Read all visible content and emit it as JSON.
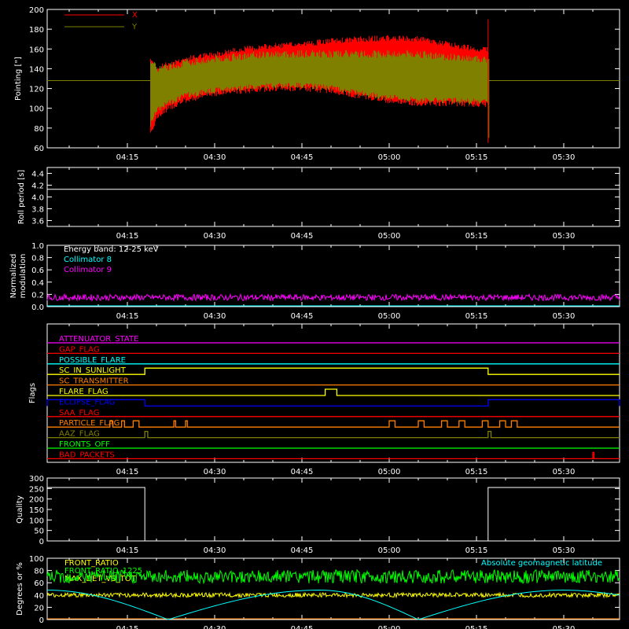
{
  "colors": {
    "background": "#000000",
    "axes": "#ffffff",
    "x": "#ff0000",
    "y": "#7f7f00",
    "cyan": "#00ffff",
    "magenta": "#ff00ff",
    "yellow": "#ffff00",
    "green": "#00ff00",
    "orange": "#ff7f00",
    "blue": "#0000ff",
    "red": "#ff0000"
  },
  "time_ticks": [
    "04:15",
    "04:30",
    "04:45",
    "05:00",
    "05:15",
    "05:30"
  ],
  "chart_data": [
    {
      "type": "area",
      "ylabel": "Pointing [\"]",
      "ylim": [
        60,
        200
      ],
      "yticks": [
        "60",
        "80",
        "100",
        "120",
        "140",
        "160",
        "180",
        "200"
      ],
      "x": [
        "04:19",
        "04:20",
        "04:22",
        "04:25",
        "04:30",
        "04:35",
        "04:40",
        "04:45",
        "04:50",
        "04:55",
        "05:00",
        "05:05",
        "05:10",
        "05:15",
        "05:17"
      ],
      "series": [
        {
          "name": "X",
          "upper": [
            150,
            140,
            145,
            150,
            155,
            160,
            163,
            165,
            168,
            170,
            171,
            170,
            165,
            160,
            160
          ],
          "lower": [
            75,
            90,
            100,
            108,
            115,
            118,
            120,
            120,
            118,
            112,
            108,
            105,
            105,
            104,
            104
          ]
        },
        {
          "name": "Y",
          "upper": [
            150,
            140,
            142,
            146,
            150,
            153,
            155,
            155,
            155,
            155,
            155,
            155,
            152,
            150,
            150
          ],
          "lower": [
            80,
            95,
            102,
            110,
            115,
            118,
            120,
            120,
            118,
            112,
            108,
            105,
            105,
            104,
            104
          ]
        }
      ],
      "baseline": 128,
      "legend": "top-left"
    },
    {
      "type": "line",
      "ylabel": "Roll period [s]",
      "ylim": [
        3.5,
        4.5
      ],
      "yticks": [
        "3.6",
        "3.8",
        "4.0",
        "4.2",
        "4.4"
      ],
      "value": 4.13
    },
    {
      "type": "line",
      "ylabel": "Normalized modulation",
      "ylim": [
        0,
        1.0
      ],
      "yticks": [
        "0.0",
        "0.2",
        "0.4",
        "0.6",
        "0.8",
        "1.0"
      ],
      "title": "Energy band: 12-25 keV",
      "series": [
        {
          "name": "Collimator 8",
          "mean": 0.0
        },
        {
          "name": "Collimator 9",
          "mean": 0.15
        }
      ]
    },
    {
      "type": "table",
      "ylabel": "Flags",
      "flags": [
        {
          "name": "ATTENUATOR_STATE",
          "color": "#ff00ff",
          "on": []
        },
        {
          "name": "GAP_FLAG",
          "color": "#ff0000",
          "on": []
        },
        {
          "name": "POSSIBLE_FLARE",
          "color": "#00ffff",
          "on": []
        },
        {
          "name": "SC_IN_SUNLIGHT",
          "color": "#ffff00",
          "on": [
            [
              "04:18",
              "05:17"
            ]
          ]
        },
        {
          "name": "SC_TRANSMITTER",
          "color": "#ff7f00",
          "on": []
        },
        {
          "name": "FLARE_FLAG",
          "color": "#ffff00",
          "on": [
            [
              "04:49",
              "04:51"
            ]
          ]
        },
        {
          "name": "ECLIPSE_FLAG",
          "color": "#0000ff",
          "on": [
            [
              "03:59",
              "04:18"
            ],
            [
              "05:17",
              "05:42"
            ]
          ]
        },
        {
          "name": "SAA_FLAG",
          "color": "#ff0000",
          "on": []
        },
        {
          "name": "PARTICLE_FLAG",
          "color": "#ff7f00",
          "on": [
            [
              "04:12",
              "04:12.5"
            ],
            [
              "04:14",
              "04:14.5"
            ],
            [
              "04:16",
              "04:17"
            ],
            [
              "04:23",
              "04:23.3"
            ],
            [
              "04:25",
              "04:25.3"
            ],
            [
              "05:00",
              "05:01"
            ],
            [
              "05:05",
              "05:06"
            ],
            [
              "05:09",
              "05:10"
            ],
            [
              "05:12",
              "05:13"
            ],
            [
              "05:16",
              "05:17"
            ],
            [
              "05:19",
              "05:20"
            ],
            [
              "05:21",
              "05:22"
            ]
          ]
        },
        {
          "name": "AAZ_FLAG",
          "color": "#7f7f00",
          "on": [
            [
              "04:18",
              "04:18.5"
            ],
            [
              "05:17",
              "05:17.5"
            ]
          ]
        },
        {
          "name": "FRONTS_OFF",
          "color": "#00ff00",
          "on": []
        },
        {
          "name": "BAD_PACKETS",
          "color": "#ff0000",
          "on": [
            [
              "05:35",
              "05:35.2"
            ]
          ]
        }
      ]
    },
    {
      "type": "line",
      "ylabel": "Quality",
      "ylim": [
        0,
        300
      ],
      "yticks": [
        "0",
        "50",
        "100",
        "150",
        "200",
        "250",
        "300"
      ],
      "x": [
        "03:59",
        "04:18",
        "04:18",
        "05:17",
        "05:17",
        "05:42"
      ],
      "values": [
        255,
        255,
        0,
        0,
        255,
        255
      ]
    },
    {
      "type": "line",
      "ylabel": "Degrees or %",
      "ylim": [
        0,
        100
      ],
      "yticks": [
        "0",
        "20",
        "40",
        "60",
        "80",
        "100"
      ],
      "series": [
        {
          "name": "FRONT_RATIO",
          "mean": 40
        },
        {
          "name": "FRONT_RATIO_1225",
          "mean": 70
        },
        {
          "name": "MAX_DET_VS_TOT",
          "mean": 0
        },
        {
          "name": "Absolute geomagnetic latitude",
          "x": [
            "03:59",
            "04:22",
            "04:48",
            "05:05",
            "05:30",
            "05:42"
          ],
          "values": [
            48,
            0,
            48,
            0,
            48,
            40
          ]
        }
      ]
    }
  ]
}
